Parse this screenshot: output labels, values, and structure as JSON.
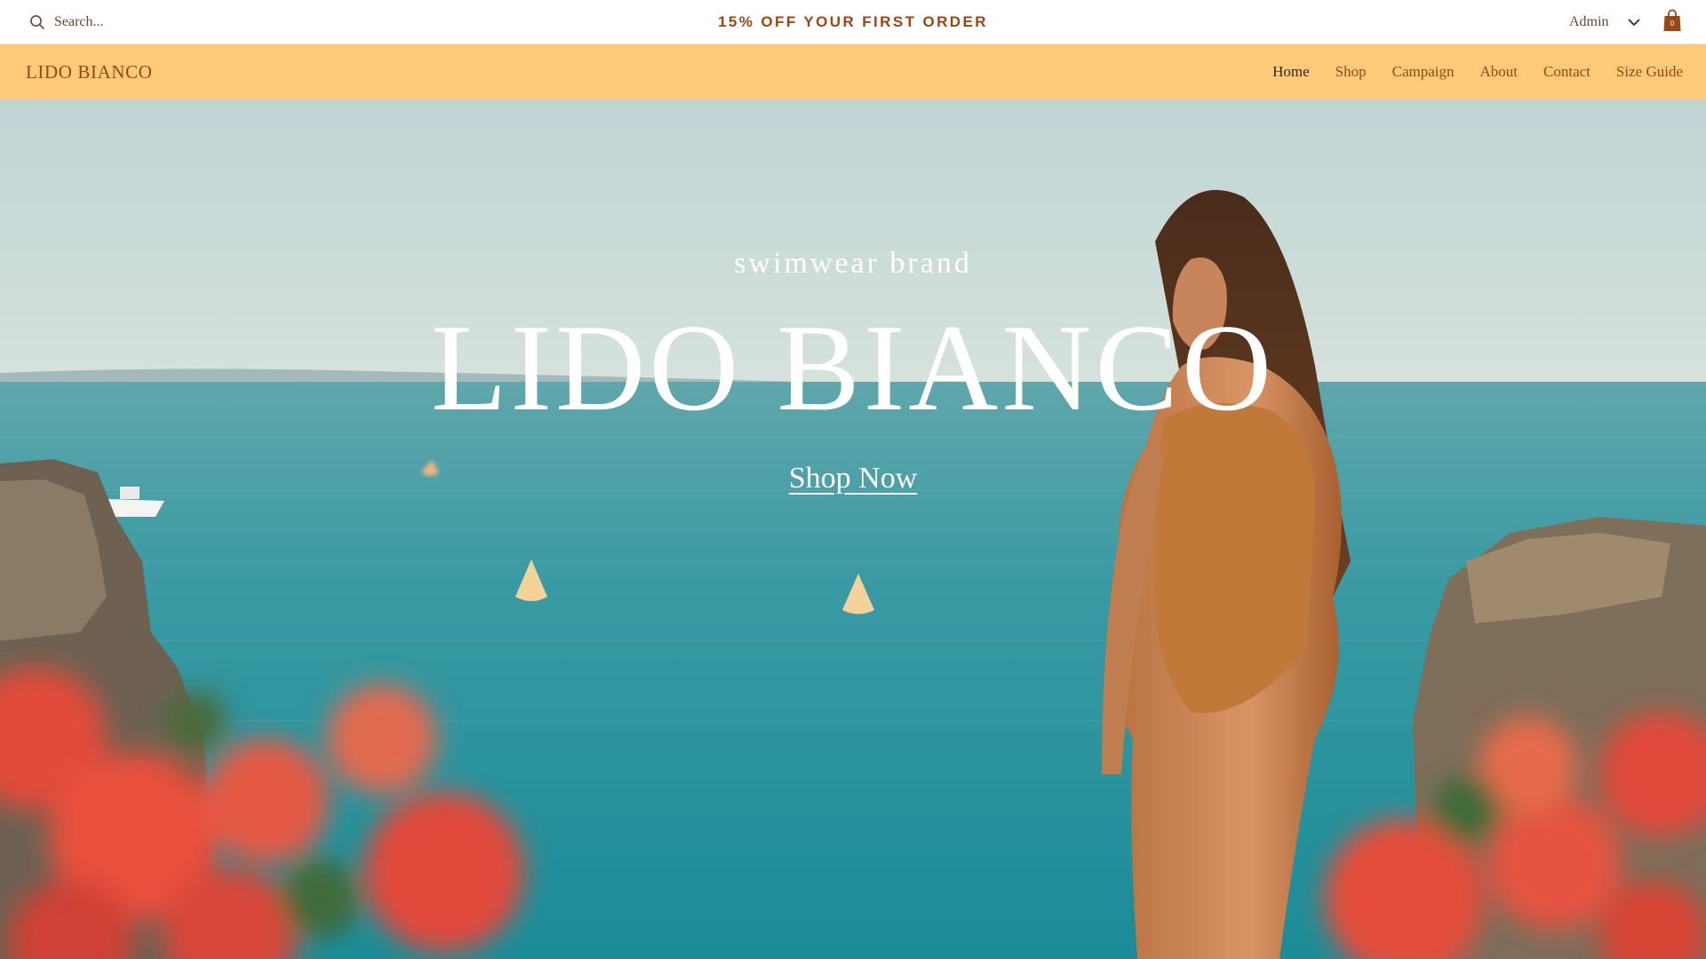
{
  "topbar": {
    "search": {
      "placeholder": "Search...",
      "icon": "search-icon"
    },
    "promo": "15% OFF YOUR FIRST ORDER",
    "account": {
      "label": "Admin",
      "icon": "chevron-down-icon"
    },
    "cart": {
      "count": "0",
      "icon": "shopping-bag-icon"
    }
  },
  "header": {
    "logo": "LIDO BIANCO",
    "nav": [
      {
        "label": "Home",
        "active": true
      },
      {
        "label": "Shop"
      },
      {
        "label": "Campaign"
      },
      {
        "label": "About"
      },
      {
        "label": "Contact"
      },
      {
        "label": "Size Guide"
      }
    ]
  },
  "hero": {
    "eyebrow": "swimwear brand",
    "title": "LIDO BIANCO",
    "cta": "Shop Now"
  },
  "colors": {
    "header_bg": "#fdca7a",
    "brand_text": "#9a4712",
    "hero_text": "#ffffff"
  }
}
